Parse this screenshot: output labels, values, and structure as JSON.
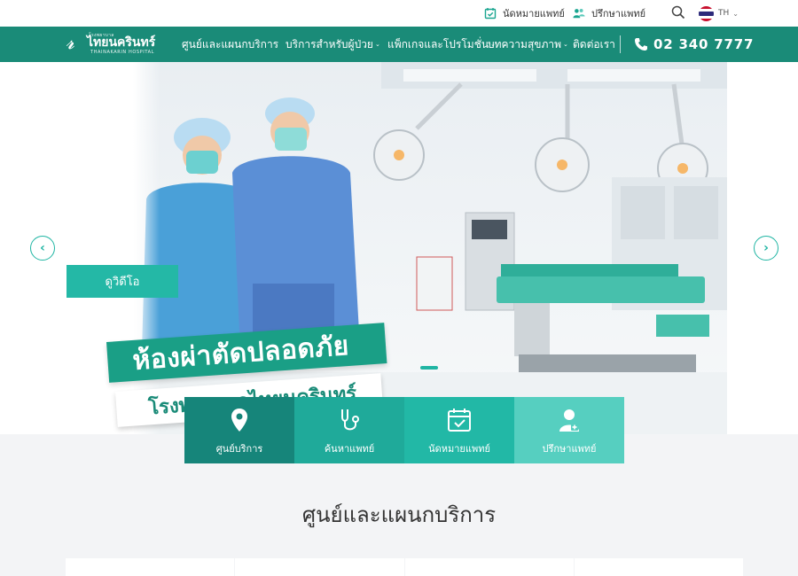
{
  "topbar": {
    "appointment_label": "นัดหมายแพทย์",
    "consult_label": "ปรึกษาแพทย์",
    "language": "TH"
  },
  "nav": {
    "logo_name": "ไทยนครินทร์",
    "logo_small": "โรงพยาบาล",
    "logo_en": "THAINAKARIN HOSPITAL",
    "items": [
      {
        "label": "ศูนย์และแผนกบริการ",
        "has_dropdown": false
      },
      {
        "label": "บริการสำหรับผู้ป่วย",
        "has_dropdown": true
      },
      {
        "label": "แพ็กเกจและโปรโมชั่น",
        "has_dropdown": true
      },
      {
        "label": "บทความสุขภาพ",
        "has_dropdown": true
      },
      {
        "label": "ติดต่อเรา",
        "has_dropdown": false
      }
    ],
    "phone": "02 340 7777"
  },
  "hero": {
    "watch_video_label": "ดูวิดีโอ",
    "banner_title": "ห้องผ่าตัดปลอดภัย",
    "banner_subtitle": "โรงพยาบาลไทยนครินทร์",
    "prev_icon": "chevron-left-icon",
    "next_icon": "chevron-right-icon"
  },
  "quick_actions": [
    {
      "label": "ศูนย์บริการ",
      "icon": "map-pin-icon",
      "color": "#16857a"
    },
    {
      "label": "ค้นหาแพทย์",
      "icon": "stethoscope-icon",
      "color": "#1faa9a"
    },
    {
      "label": "นัดหมายแพทย์",
      "icon": "calendar-check-icon",
      "color": "#22b8a6"
    },
    {
      "label": "ปรึกษาแพทย์",
      "icon": "doctor-consult-icon",
      "color": "#56cfc0"
    }
  ],
  "services": {
    "title": "ศูนย์และแผนกบริการ"
  },
  "colors": {
    "brand": "#1a8b78",
    "accent": "#24b8a6"
  }
}
